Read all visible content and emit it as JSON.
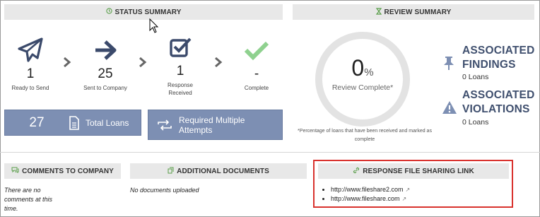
{
  "status_summary": {
    "title": "STATUS SUMMARY",
    "header_icon": "clock-icon",
    "steps": [
      {
        "icon": "paper-plane-icon",
        "count": "1",
        "label": "Ready to Send"
      },
      {
        "icon": "arrow-right-icon",
        "count": "25",
        "label": "Sent to Company"
      },
      {
        "icon": "checkbox-icon",
        "count": "1",
        "label": "Response Received"
      },
      {
        "icon": "checkmark-icon",
        "count": "-",
        "label": "Complete"
      }
    ],
    "total_loans": {
      "count": "27",
      "label": "Total Loans",
      "icon": "document-icon"
    },
    "required_attempts": {
      "label": "Required Multiple Attempts",
      "icon": "retry-icon"
    }
  },
  "review_summary": {
    "title": "REVIEW SUMMARY",
    "header_icon": "hourglass-icon",
    "percent_value": "0",
    "percent_sign": "%",
    "percent_label": "Review Complete*",
    "footnote": "*Percentage of loans that have been received and marked as complete",
    "findings": {
      "title": "ASSOCIATED FINDINGS",
      "sub": "0 Loans",
      "icon": "pin-icon"
    },
    "violations": {
      "title": "ASSOCIATED VIOLATIONS",
      "sub": "0 Loans",
      "icon": "warning-icon"
    }
  },
  "comments": {
    "title": "COMMENTS TO COMPANY",
    "header_icon": "comments-icon",
    "empty_text": "There are no comments at this time."
  },
  "additional_docs": {
    "title": "ADDITIONAL DOCUMENTS",
    "header_icon": "copy-icon",
    "empty_text": "No documents uploaded"
  },
  "file_sharing": {
    "title": "RESPONSE FILE SHARING LINK",
    "header_icon": "link-icon",
    "links": [
      "http://www.fileshare2.com",
      "http://www.fileshare.com"
    ],
    "external_icon": "external-link-icon"
  },
  "colors": {
    "header_bg": "#e8e8e8",
    "accent_green": "#5a9e4a",
    "button_bg": "#7d8fb3",
    "title_navy": "#3f4f6e",
    "highlight_red": "#d9322e",
    "icon_navy": "#3b4a6b",
    "check_green": "#8fd18f"
  }
}
